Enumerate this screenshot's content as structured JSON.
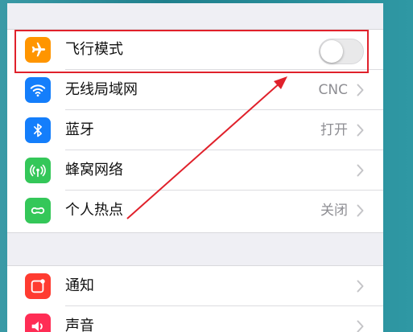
{
  "settings": {
    "group1": [
      {
        "label": "飞行模式",
        "icon": "airplane-icon",
        "icon_bg": "#ff9500",
        "control": "toggle",
        "toggle_on": false
      },
      {
        "label": "无线局域网",
        "icon": "wifi-icon",
        "icon_bg": "#147efb",
        "detail": "CNC",
        "control": "chevron"
      },
      {
        "label": "蓝牙",
        "icon": "bluetooth-icon",
        "icon_bg": "#147efb",
        "detail": "打开",
        "control": "chevron"
      },
      {
        "label": "蜂窝网络",
        "icon": "cellular-icon",
        "icon_bg": "#34c759",
        "detail": "",
        "control": "chevron"
      },
      {
        "label": "个人热点",
        "icon": "hotspot-icon",
        "icon_bg": "#34c759",
        "detail": "关闭",
        "control": "chevron"
      }
    ],
    "group2": [
      {
        "label": "通知",
        "icon": "notifications-icon",
        "icon_bg": "#ff3b30",
        "control": "chevron"
      },
      {
        "label": "声音",
        "icon": "sounds-icon",
        "icon_bg": "#ff2d55",
        "control": "chevron"
      }
    ]
  },
  "annotation": {
    "color": "#e0212b",
    "highlight_target": "飞行模式"
  }
}
